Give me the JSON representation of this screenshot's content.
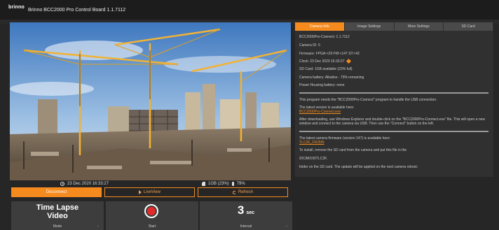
{
  "titlebar": {
    "logo_text": "brinno",
    "logo_sub": "",
    "title": "Brinno BCC2000 Pro Control Board 1.1.7112"
  },
  "status": {
    "datetime": "23 Dec 2020 16:33:27",
    "sd": "1GB (23%)",
    "battery": "79%"
  },
  "buttons": {
    "disconnect": "Disconnect",
    "liveview": "LiveView",
    "refresh": "Refresh"
  },
  "tiles": {
    "mode_line1": "Time Lapse",
    "mode_line2": "Video",
    "mode_label": "Mode",
    "start_label": "Start",
    "interval_value": "3",
    "interval_unit": "sec",
    "interval_label": "Interval"
  },
  "tabs": [
    "Camera Info",
    "Image Settings",
    "More Settings",
    "SD Card"
  ],
  "info": {
    "model": "BCC2000Pro-Connect: 1.1.7112",
    "camera_id": "Camera ID: 0",
    "firmware": "Firmware: FPGA:<29 FW:<147 ST:<42",
    "clock": "Clock: 23 Dec 2020 16:33:27",
    "sdcard": "SD Card: 1GB available (23% full)",
    "battery": "Camera battery: Alkaline - 79% remaining",
    "power": "Power Housing battery: none",
    "msg1": "This program needs the \"BCC2000Pro-Connect\" program to handle the USB connection.",
    "msg2": "The latest version is available here:",
    "link1": "BCC2000Pro-Connect.exe",
    "msg3a": "After downloading, use Windows Explorer and double-click on the \"BCC2000Pro-Connect.exe\" file. This will open a new",
    "msg3b": "window and connect to the camera via USB. Then use the \"Connect\" button on the left.",
    "msg4": "The latest camera firmware (version 147) is available here:",
    "link2": "TLC2K_FW.BIN",
    "msg5": "To install, remove the SD card from the camera and put this file in the",
    "msg6": "/DCIM/100TLC2K",
    "msg7": "folder on the SD card. The update will be applied on the next camera reboot."
  },
  "colors": {
    "accent": "#f58b1f",
    "background": "#262626",
    "tile": "#3d3d3d",
    "record": "#e32b2b"
  },
  "icons": [
    "clock-icon",
    "sd-card-icon",
    "battery-icon",
    "play-icon",
    "refresh-icon",
    "record-icon",
    "wrench-icon"
  ]
}
